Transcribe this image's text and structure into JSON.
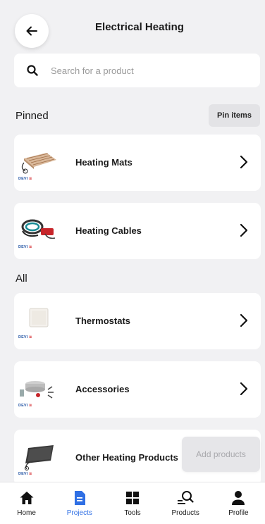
{
  "header": {
    "title": "Electrical Heating"
  },
  "search": {
    "placeholder": "Search for a product"
  },
  "pinned": {
    "title": "Pinned",
    "pin_button": "Pin items",
    "items": [
      {
        "label": "Heating Mats",
        "brand": "DEVI"
      },
      {
        "label": "Heating Cables",
        "brand": "DEVI"
      }
    ]
  },
  "all": {
    "title": "All",
    "items": [
      {
        "label": "Thermostats",
        "brand": "DEVI"
      },
      {
        "label": "Accessories",
        "brand": "DEVI"
      },
      {
        "label": "Other Heating Products",
        "brand": "DEVI"
      }
    ]
  },
  "add_products_label": "Add products",
  "nav": {
    "active": "Projects",
    "accent_color": "#2f6fe4",
    "items": [
      {
        "label": "Home",
        "icon": "home-icon"
      },
      {
        "label": "Projects",
        "icon": "document-icon"
      },
      {
        "label": "Tools",
        "icon": "grid-icon"
      },
      {
        "label": "Products",
        "icon": "search-products-icon"
      },
      {
        "label": "Profile",
        "icon": "person-icon"
      }
    ]
  }
}
